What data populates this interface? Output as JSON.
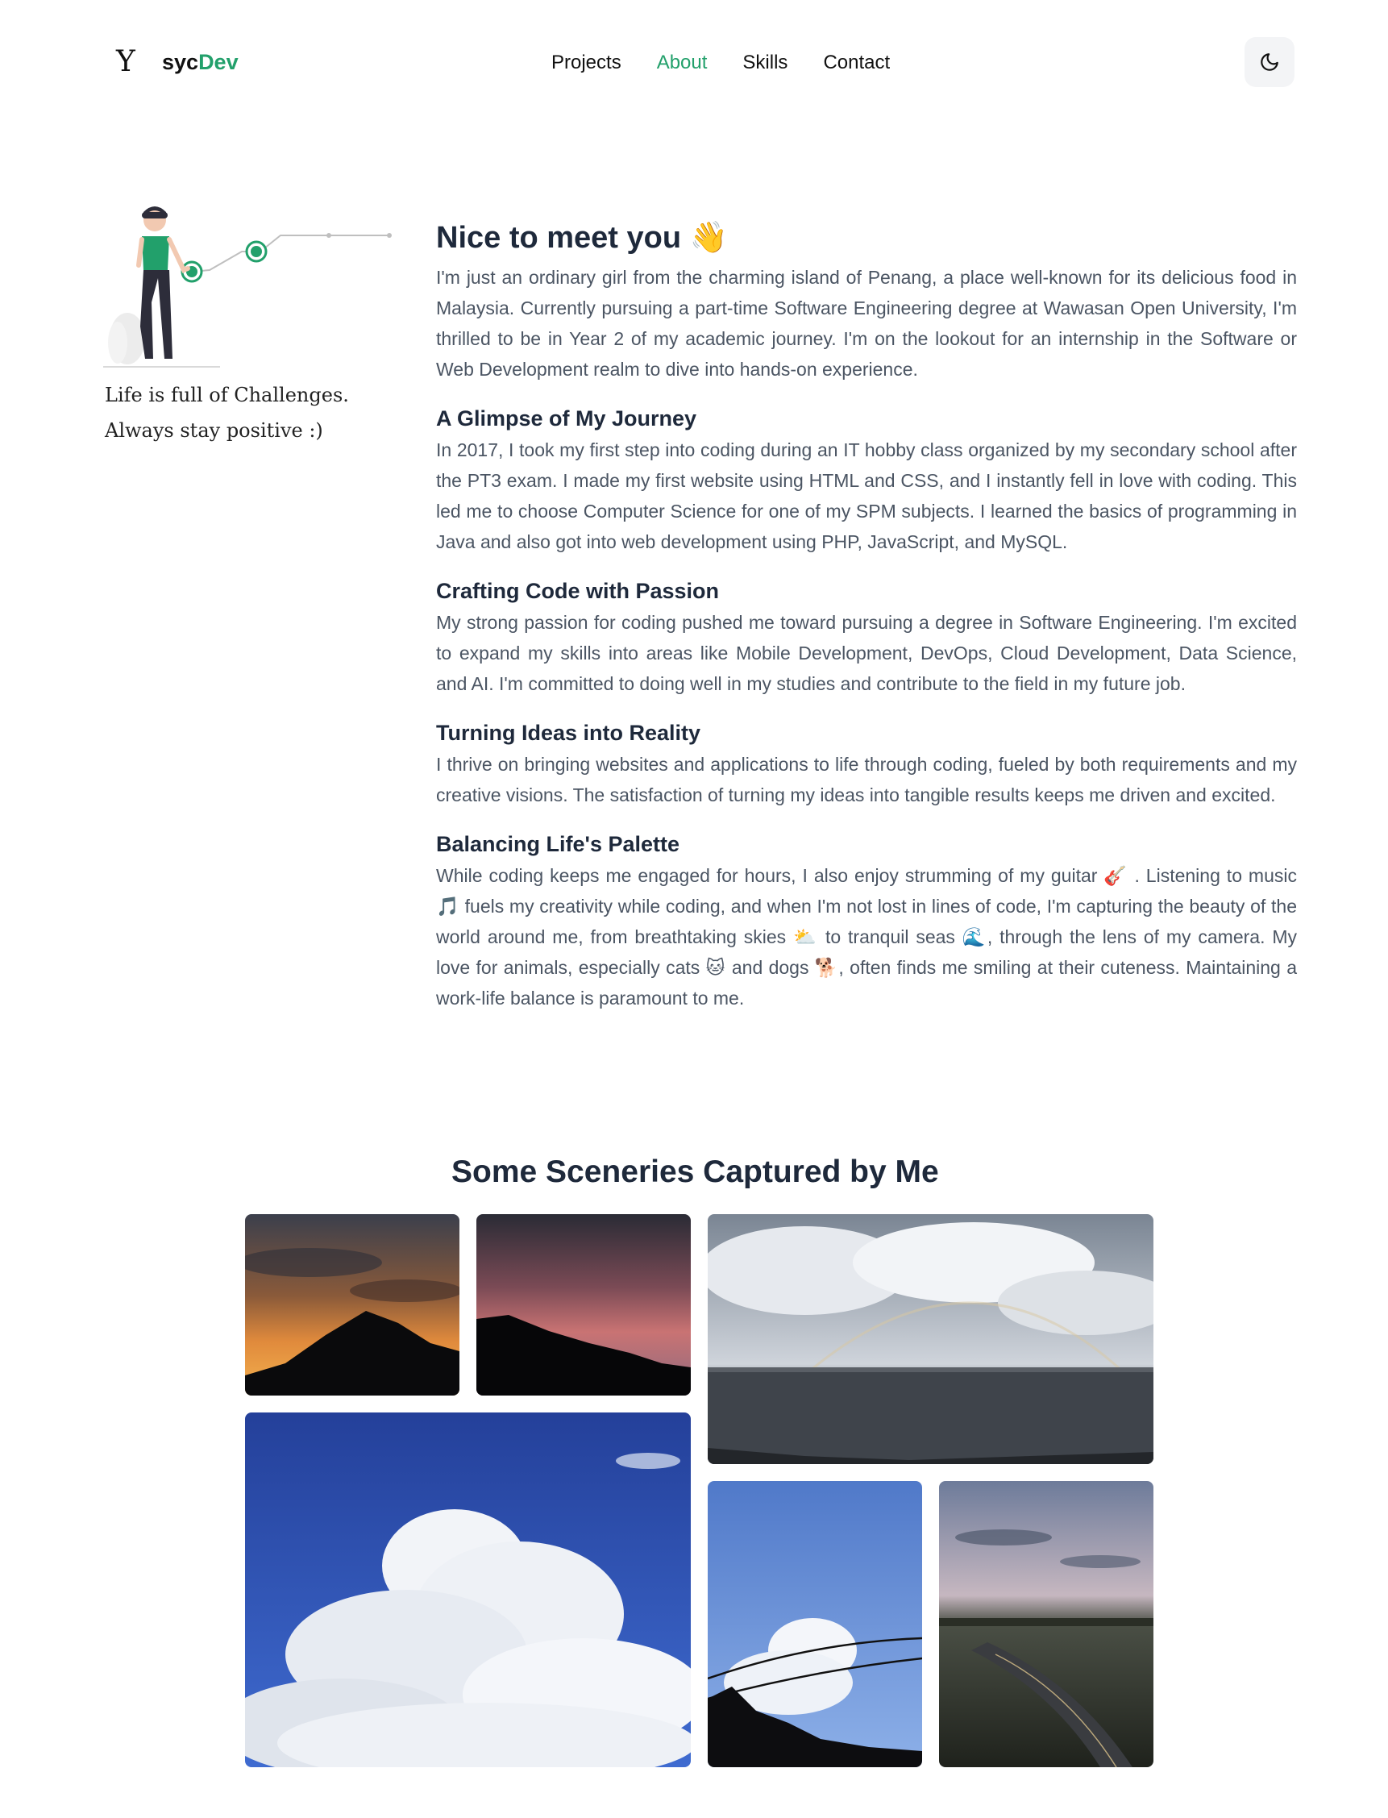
{
  "header": {
    "logo_mark": "Y",
    "logo_text_a": "syc",
    "logo_text_b": "Dev",
    "nav": [
      "Projects",
      "About",
      "Skills",
      "Contact"
    ],
    "active_nav": "About",
    "theme_icon": "moon-icon"
  },
  "sidebar": {
    "quote_line1": "Life is full of Challenges.",
    "quote_line2": "Always stay positive :)"
  },
  "about": {
    "title": "Nice to meet you",
    "title_emoji": "👋",
    "intro": "I'm just an ordinary girl from the charming island of Penang, a place well-known for its delicious food in Malaysia. Currently pursuing a part-time Software Engineering degree at Wawasan Open University, I'm thrilled to be in Year 2 of my academic journey. I'm on the lookout for an internship in the Software or Web Development realm to dive into hands-on experience.",
    "sections": [
      {
        "heading": "A Glimpse of My Journey",
        "text": "In 2017, I took my first step into coding during an IT hobby class organized by my secondary school after the PT3 exam. I made my first website using HTML and CSS, and I instantly fell in love with coding. This led me to choose Computer Science for one of my SPM subjects. I learned the basics of programming in Java and also got into web development using PHP, JavaScript, and MySQL."
      },
      {
        "heading": "Crafting Code with Passion",
        "text": "My strong passion for coding pushed me toward pursuing a degree in Software Engineering. I'm excited to expand my skills into areas like Mobile Development, DevOps, Cloud Development, Data Science, and AI. I'm committed to doing well in my studies and contribute to the field in my future job."
      },
      {
        "heading": "Turning Ideas into Reality",
        "text": "I thrive on bringing websites and applications to life through coding, fueled by both requirements and my creative visions. The satisfaction of turning my ideas into tangible results keeps me driven and excited."
      },
      {
        "heading": "Balancing Life's Palette",
        "text": "While coding keeps me engaged for hours, I also enjoy strumming of my guitar 🎸 . Listening to music 🎵 fuels my creativity while coding, and when I'm not lost in lines of code, I'm capturing the beauty of the world around me, from breathtaking skies ⛅ to tranquil seas 🌊, through the lens of my camera. My love for animals, especially cats 🐱 and dogs 🐕, often finds me smiling at their cuteness. Maintaining a work-life balance is paramount to me."
      }
    ]
  },
  "gallery": {
    "title": "Some Sceneries Captured by Me",
    "photos": [
      "sunset-hill",
      "pink-sky-hill",
      "rainbow-sea",
      "cloud-blue-sky",
      "cloud-wire",
      "highway-dusk"
    ]
  },
  "colors": {
    "accent": "#22a06b",
    "heading": "#1e293b",
    "body": "#4b5563"
  }
}
